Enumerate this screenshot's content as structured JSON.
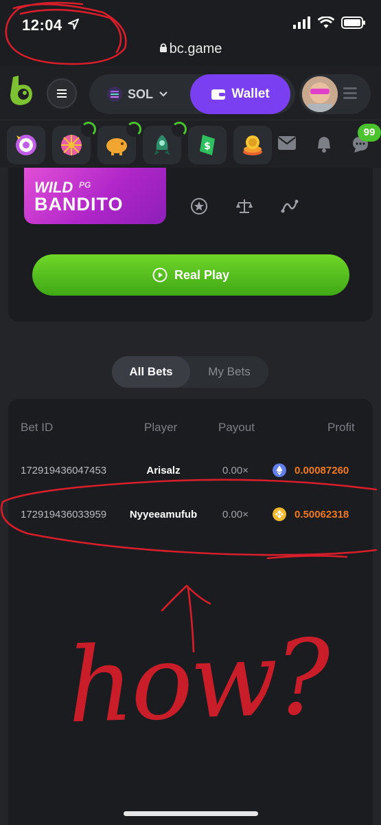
{
  "status_bar": {
    "time": "12:04",
    "url": "bc.game"
  },
  "header": {
    "currency": "SOL",
    "wallet_label": "Wallet",
    "notification_count": "99"
  },
  "game": {
    "thumb_title_1": "WILD",
    "thumb_title_2": "BANDITO",
    "provider": "PG",
    "play_label": "Real Play"
  },
  "bets": {
    "tabs": [
      "All Bets",
      "My Bets"
    ],
    "columns": [
      "Bet ID",
      "Player",
      "Payout",
      "Profit"
    ],
    "rows": [
      {
        "id": "172919436047453",
        "player": "Arisalz",
        "payout": "0.00×",
        "coin": "eth-icon",
        "profit": "0.00087260"
      },
      {
        "id": "172919436033959",
        "player": "Nyyeeamufub",
        "payout": "0.00×",
        "coin": "bnb-icon",
        "profit": "0.50062318"
      }
    ]
  },
  "annotation": {
    "handwritten_text": "how?"
  },
  "colors": {
    "accent_purple": "#7b3ff2",
    "accent_green": "#4ac32e",
    "profit_orange": "#f07a25",
    "annotation_red": "#d81e2a"
  }
}
